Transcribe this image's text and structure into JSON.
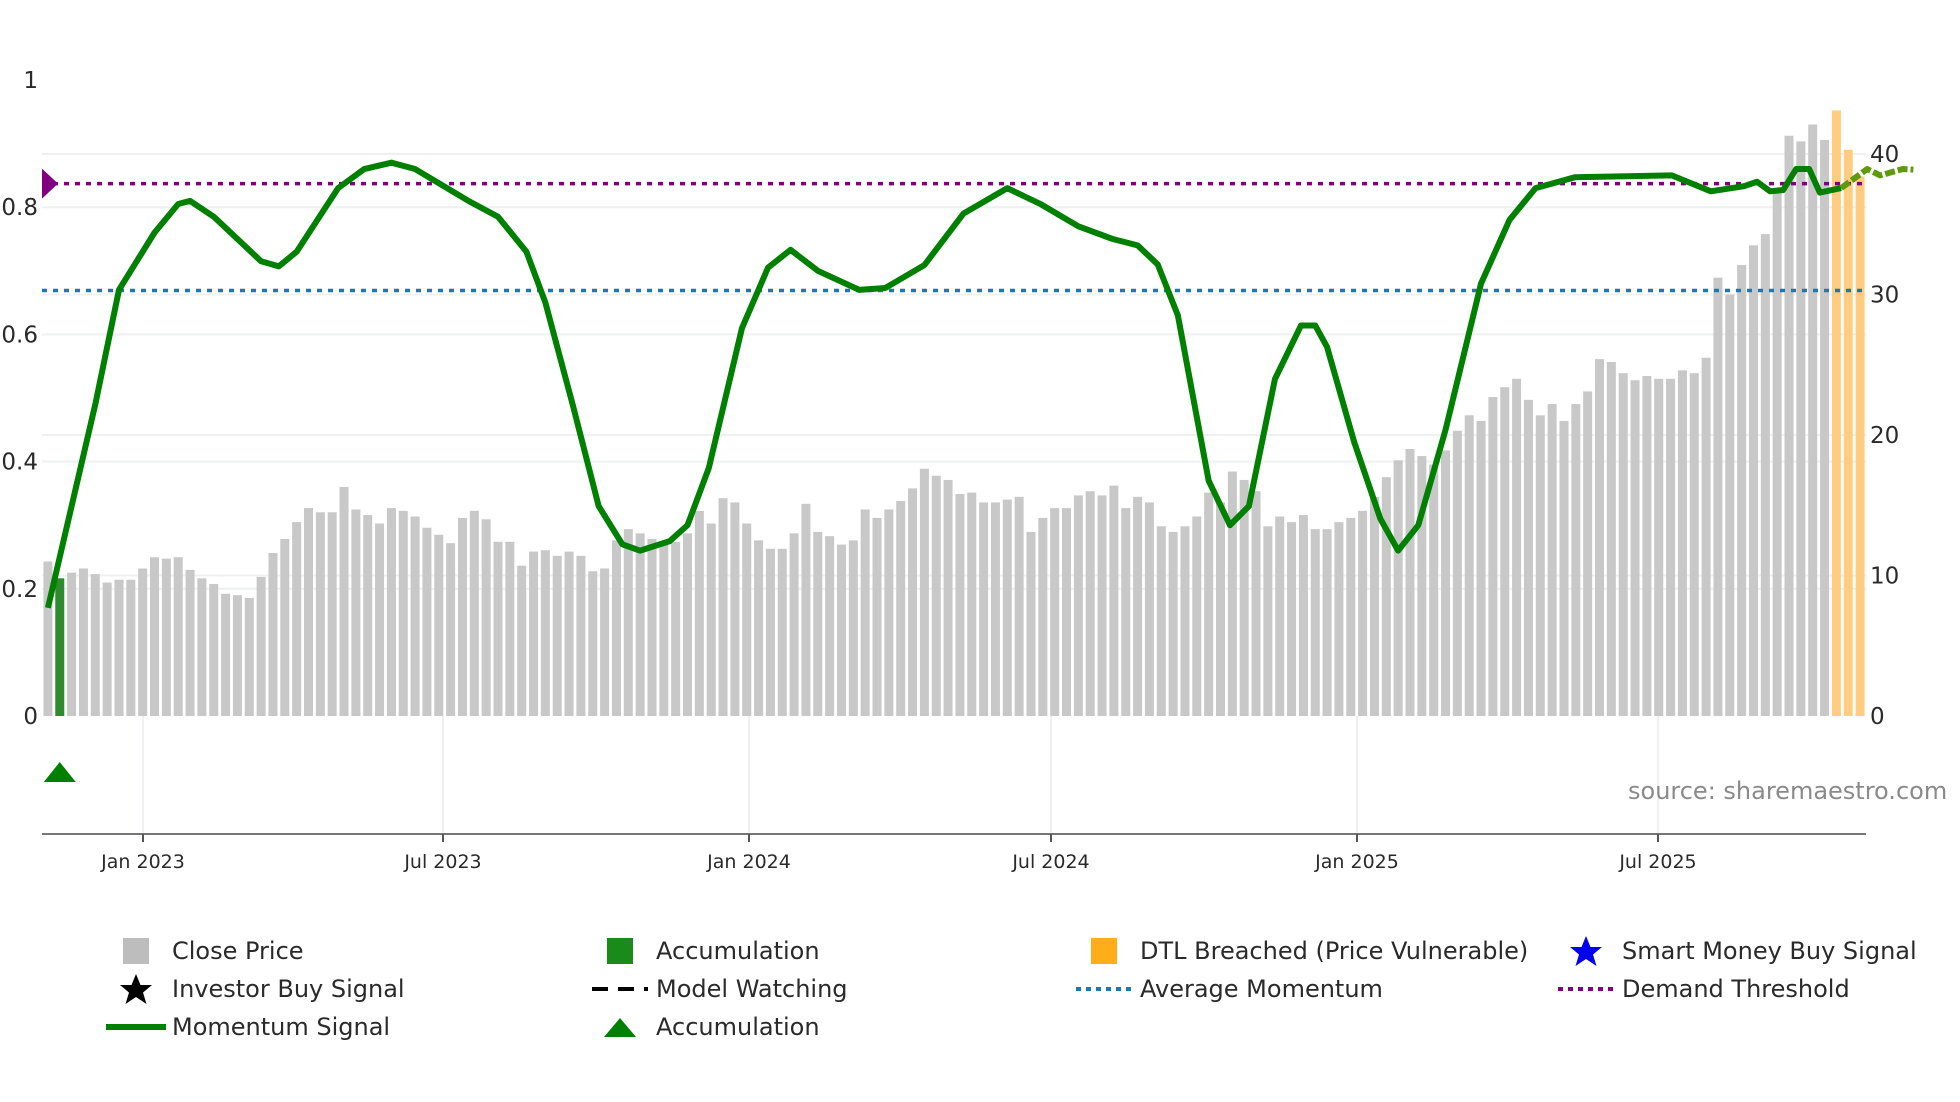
{
  "chart_data": {
    "type": "bar+line",
    "title": "",
    "source": "source: sharemaestro.com",
    "x_ticks": [
      "Jan 2023",
      "Jul 2023",
      "Jan 2024",
      "Jul 2024",
      "Jan 2025",
      "Jul 2025"
    ],
    "left_axis": {
      "ticks": [
        "0",
        "0.2",
        "0.4",
        "0.6",
        "0.8",
        "1"
      ],
      "range": [
        0,
        1
      ]
    },
    "right_axis": {
      "ticks": [
        "0",
        "10",
        "20",
        "30",
        "40"
      ],
      "range": [
        0,
        40
      ]
    },
    "close_price_weekly": [
      11,
      9.8,
      10.2,
      10.5,
      10.1,
      9.5,
      9.7,
      9.7,
      10.5,
      11.3,
      11.2,
      11.3,
      10.4,
      9.8,
      9.4,
      8.7,
      8.6,
      8.4,
      9.9,
      11.6,
      12.6,
      13.8,
      14.8,
      14.5,
      14.5,
      16.3,
      14.7,
      14.3,
      13.7,
      14.8,
      14.6,
      14.2,
      13.4,
      12.9,
      12.3,
      14.1,
      14.6,
      14,
      12.4,
      12.4,
      10.7,
      11.7,
      11.8,
      11.4,
      11.7,
      11.4,
      10.3,
      10.5,
      12.5,
      13.3,
      13,
      12.6,
      12.4,
      12.4,
      13,
      14.6,
      13.7,
      15.5,
      15.2,
      13.7,
      12.5,
      11.9,
      11.9,
      13,
      15.1,
      13.1,
      12.8,
      12.2,
      12.5,
      14.7,
      14.1,
      14.7,
      15.3,
      16.2,
      17.6,
      17.1,
      16.8,
      15.8,
      15.9,
      15.2,
      15.2,
      15.4,
      15.6,
      13.1,
      14.1,
      14.8,
      14.8,
      15.7,
      16,
      15.7,
      16.4,
      14.8,
      15.6,
      15.2,
      13.5,
      13.1,
      13.5,
      14.2,
      15.9,
      15.2,
      17.4,
      16.8,
      16,
      13.5,
      14.2,
      13.8,
      14.3,
      13.3,
      13.3,
      13.8,
      14.1,
      14.6,
      15.6,
      17,
      18.2,
      19,
      18.5,
      17.9,
      18.9,
      20.3,
      21.4,
      21,
      22.7,
      23.4,
      24,
      22.5,
      21.4,
      22.2,
      21,
      22.2,
      23.1,
      25.4,
      25.2,
      24.4,
      23.9,
      24.2,
      24,
      24,
      24.6,
      24.4,
      25.5,
      31.2,
      30,
      32.1,
      33.5,
      34.3,
      37.5,
      41.3,
      40.9,
      42.1,
      41,
      43.1,
      40.3,
      38.4
    ],
    "accumulation_bar_indices": [
      1
    ],
    "dtl_breached_start_index": 151,
    "momentum_signal_anchors": [
      [
        0,
        0.17
      ],
      [
        1,
        0.25
      ],
      [
        4,
        0.49
      ],
      [
        6,
        0.67
      ],
      [
        9,
        0.76
      ],
      [
        11,
        0.805
      ],
      [
        12,
        0.81
      ],
      [
        14,
        0.785
      ],
      [
        18,
        0.715
      ],
      [
        19.5,
        0.707
      ],
      [
        21,
        0.73
      ],
      [
        24.5,
        0.83
      ],
      [
        26.7,
        0.86
      ],
      [
        29,
        0.87
      ],
      [
        31,
        0.86
      ],
      [
        35.5,
        0.81
      ],
      [
        38,
        0.785
      ],
      [
        40.4,
        0.73
      ],
      [
        42,
        0.65
      ],
      [
        44.3,
        0.49
      ],
      [
        46.5,
        0.33
      ],
      [
        48.5,
        0.27
      ],
      [
        50,
        0.26
      ],
      [
        52.5,
        0.275
      ],
      [
        54,
        0.3
      ],
      [
        55.8,
        0.39
      ],
      [
        58.6,
        0.61
      ],
      [
        60.8,
        0.705
      ],
      [
        62.7,
        0.733
      ],
      [
        65,
        0.7
      ],
      [
        68.5,
        0.67
      ],
      [
        70.7,
        0.673
      ],
      [
        74,
        0.709
      ],
      [
        77.3,
        0.79
      ],
      [
        81,
        0.83
      ],
      [
        83.8,
        0.805
      ],
      [
        87,
        0.77
      ],
      [
        89.9,
        0.75
      ],
      [
        92,
        0.74
      ],
      [
        93.7,
        0.71
      ],
      [
        95.4,
        0.63
      ],
      [
        98,
        0.37
      ],
      [
        99.8,
        0.3
      ],
      [
        101.4,
        0.33
      ],
      [
        103.6,
        0.53
      ],
      [
        105.8,
        0.614
      ],
      [
        107,
        0.614
      ],
      [
        108,
        0.58
      ],
      [
        110.3,
        0.43
      ],
      [
        112.5,
        0.31
      ],
      [
        114,
        0.26
      ],
      [
        115.7,
        0.3
      ],
      [
        118,
        0.45
      ],
      [
        121,
        0.68
      ],
      [
        123.4,
        0.78
      ],
      [
        125.6,
        0.83
      ],
      [
        128.9,
        0.847
      ],
      [
        137.1,
        0.85
      ],
      [
        140.4,
        0.825
      ],
      [
        143.2,
        0.833
      ],
      [
        144.3,
        0.84
      ],
      [
        145.4,
        0.825
      ],
      [
        146.5,
        0.827
      ],
      [
        147.6,
        0.86
      ],
      [
        148.7,
        0.86
      ],
      [
        149.6,
        0.823
      ],
      [
        151.4,
        0.83
      ],
      [
        153.6,
        0.86
      ],
      [
        154.7,
        0.85
      ],
      [
        156.6,
        0.86
      ],
      [
        157.5,
        0.859
      ]
    ],
    "demand_threshold": 0.837,
    "average_momentum": 0.669,
    "accumulation_marker_index": 1,
    "legend": [
      {
        "label": "Close Price",
        "color": "#bdbdbd",
        "icon": "square"
      },
      {
        "label": "Accumulation",
        "color": "#1a8a1a",
        "icon": "square"
      },
      {
        "label": "DTL Breached (Price Vulnerable)",
        "color": "#ffae1a",
        "icon": "square"
      },
      {
        "label": "Smart Money Buy Signal",
        "color": "#0000ee",
        "icon": "star"
      },
      {
        "label": "Investor Buy Signal",
        "color": "#000000",
        "icon": "star"
      },
      {
        "label": "Model Watching",
        "color": "#000000",
        "icon": "dash"
      },
      {
        "label": "Average Momentum",
        "color": "#1f77b4",
        "icon": "dot"
      },
      {
        "label": "Demand Threshold",
        "color": "#800080",
        "icon": "dot"
      },
      {
        "label": "Momentum Signal",
        "color": "#008000",
        "icon": "line"
      },
      {
        "label": "Accumulation",
        "color": "#008000",
        "icon": "triangle"
      }
    ],
    "colors": {
      "price": "#c8c8c8",
      "accum": "#2e8b2e",
      "dtl": "#ffcc80",
      "momentum": "#008000",
      "avg": "#1f77b4",
      "demand": "#800080"
    }
  }
}
